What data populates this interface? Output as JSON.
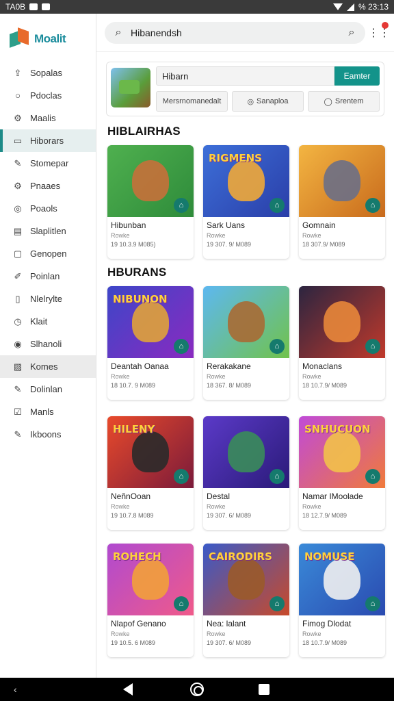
{
  "status": {
    "time": "TA0B",
    "right_text": "% 23:13"
  },
  "brand": {
    "name": "Moalit"
  },
  "sidebar": {
    "items": [
      {
        "label": "Sopalas",
        "icon": "upload-icon",
        "glyph": "⇪"
      },
      {
        "label": "Pdoclas",
        "icon": "circle-icon",
        "glyph": "○"
      },
      {
        "label": "Maalis",
        "icon": "settings-icon",
        "glyph": "⚙"
      },
      {
        "label": "Hiborars",
        "icon": "window-icon",
        "glyph": "▭"
      },
      {
        "label": "Stomepar",
        "icon": "edit-icon",
        "glyph": "✎"
      },
      {
        "label": "Pnaaes",
        "icon": "gear-icon",
        "glyph": "⚙"
      },
      {
        "label": "Poaols",
        "icon": "info-icon",
        "glyph": "◎"
      },
      {
        "label": "Slaplitlen",
        "icon": "grid-icon",
        "glyph": "▤"
      },
      {
        "label": "Genopen",
        "icon": "folder-icon",
        "glyph": "▢"
      },
      {
        "label": "Poinlan",
        "icon": "pen-icon",
        "glyph": "✐"
      },
      {
        "label": "Nlelrylte",
        "icon": "file-icon",
        "glyph": "▯"
      },
      {
        "label": "Klait",
        "icon": "clock-icon",
        "glyph": "◷"
      },
      {
        "label": "Slhanoli",
        "icon": "settings-icon",
        "glyph": "◉"
      },
      {
        "label": "Komes",
        "icon": "image-icon",
        "glyph": "▨"
      },
      {
        "label": "Dolinlan",
        "icon": "edit-icon",
        "glyph": "✎"
      },
      {
        "label": "Manls",
        "icon": "check-icon",
        "glyph": "☑"
      },
      {
        "label": "Ikboons",
        "icon": "edit-icon",
        "glyph": "✎"
      }
    ]
  },
  "search": {
    "value": "Hibanendsh"
  },
  "hero": {
    "input_value": "Hibarn",
    "button_label": "Eamter",
    "actions": [
      {
        "label": "Mersrnomanedalt",
        "icon": ""
      },
      {
        "label": "Sanaploa",
        "icon": "◎"
      },
      {
        "label": "Srentem",
        "icon": "◯"
      }
    ]
  },
  "sections": [
    {
      "title": "HIBLAIRHAS",
      "cards": [
        {
          "title": "Hibunban",
          "sub": "Rowke",
          "meta": "19 10.3.9 M085)",
          "art": [
            "#4fb04f",
            "#2e8b3a"
          ],
          "figure": "#c7703a",
          "logo": ""
        },
        {
          "title": "Sark Uans",
          "sub": "Rowke",
          "meta": "19 307. 9/ M089",
          "art": [
            "#3d6fd8",
            "#2a3ea8"
          ],
          "figure": "#f0a938",
          "logo": "RIGMENS"
        },
        {
          "title": "Gomnain",
          "sub": "Rowke",
          "meta": "18 307.9/ M089",
          "art": [
            "#f3b542",
            "#c86a1c"
          ],
          "figure": "#6b6f86",
          "logo": ""
        }
      ]
    },
    {
      "title": "HBURANS",
      "cards": [
        {
          "title": "Deantah Oanaa",
          "sub": "Rowke",
          "meta": "18 10.7. 9 M089",
          "art": [
            "#3d46c8",
            "#8a2ac0"
          ],
          "figure": "#e0a23a",
          "logo": "NIBUNON"
        },
        {
          "title": "Rerakakane",
          "sub": "Rowke",
          "meta": "18 367. 8/ M089",
          "art": [
            "#5db8f0",
            "#71c24b"
          ],
          "figure": "#a86a34",
          "logo": ""
        },
        {
          "title": "Monaclans",
          "sub": "Rowke",
          "meta": "18 10.7.9/ M089",
          "art": [
            "#2c2540",
            "#c0392b"
          ],
          "figure": "#e8873a",
          "logo": ""
        }
      ]
    },
    {
      "title": "",
      "cards": [
        {
          "title": "NeñnOoan",
          "sub": "Rowke",
          "meta": "19 10.7.8 M089",
          "art": [
            "#e84a2b",
            "#7a1a3a"
          ],
          "figure": "#2a2a2a",
          "logo": "HILENY"
        },
        {
          "title": "Destal",
          "sub": "Rowke",
          "meta": "19 307. 6/ M089",
          "art": [
            "#5b3ac8",
            "#2a1a78"
          ],
          "figure": "#3a8c5a",
          "logo": ""
        },
        {
          "title": "Namar IMoolade",
          "sub": "Rowke",
          "meta": "18 12.7.9/ M089",
          "art": [
            "#c04ad8",
            "#f07a3a"
          ],
          "figure": "#f2c14a",
          "logo": "SNHUCUON"
        }
      ]
    },
    {
      "title": "",
      "cards": [
        {
          "title": "Nlapof Genano",
          "sub": "Rowke",
          "meta": "19 10.5. 6 M089",
          "art": [
            "#b04ad0",
            "#f05a8a"
          ],
          "figure": "#f2a03a",
          "logo": "ROHECH"
        },
        {
          "title": "Nea: lalant",
          "sub": "Rowke",
          "meta": "19 307. 6/ M089",
          "art": [
            "#3a5ac8",
            "#c84a2a"
          ],
          "figure": "#9a5a2a",
          "logo": "CAIRODIRS"
        },
        {
          "title": "Fimog Dlodat",
          "sub": "Rowke",
          "meta": "18 10.7.9/ M089",
          "art": [
            "#3a8ad8",
            "#2a4ab0"
          ],
          "figure": "#f0f0f0",
          "logo": "NOMUSE"
        }
      ]
    }
  ]
}
